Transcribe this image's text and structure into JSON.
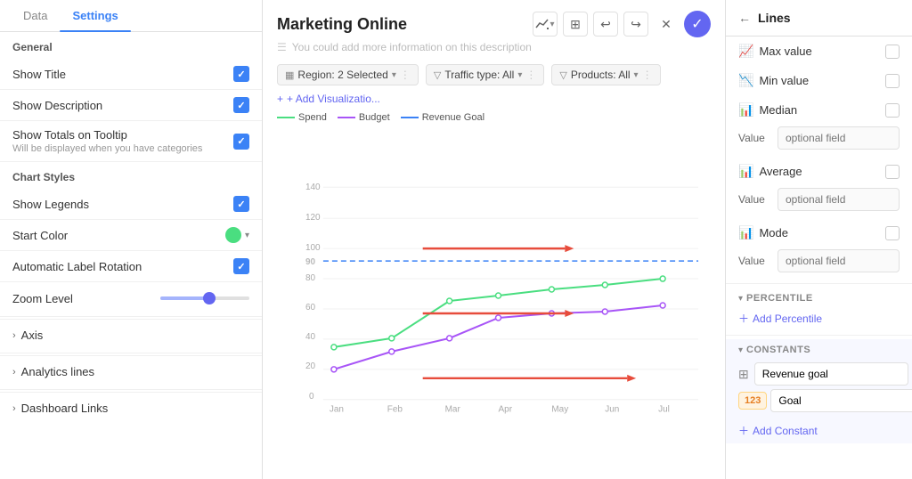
{
  "tabs": [
    {
      "label": "Data",
      "active": false
    },
    {
      "label": "Settings",
      "active": true
    }
  ],
  "left": {
    "general_label": "General",
    "show_title": "Show Title",
    "show_description": "Show Description",
    "show_totals": "Show Totals on Tooltip",
    "show_totals_sub": "Will be displayed when you have categories",
    "chart_styles": "Chart Styles",
    "show_legends": "Show Legends",
    "start_color": "Start Color",
    "auto_label": "Automatic Label Rotation",
    "zoom_level": "Zoom Level",
    "axis": "Axis",
    "analytics_lines": "Analytics lines",
    "dashboard_links": "Dashboard Links"
  },
  "chart": {
    "title": "Marketing Online",
    "description_placeholder": "You could add more information on this description",
    "filters": [
      {
        "label": "Region: 2 Selected",
        "icon": "▦"
      },
      {
        "label": "Traffic type: All",
        "icon": "▽"
      },
      {
        "label": "Products: All",
        "icon": "▽"
      }
    ],
    "add_vis": "+ Add Visualizatio...",
    "legend": [
      {
        "label": "Spend",
        "color": "#4ade80"
      },
      {
        "label": "Budget",
        "color": "#a855f7"
      },
      {
        "label": "Revenue Goal",
        "color": "#3b82f6"
      }
    ]
  },
  "right": {
    "title": "Lines",
    "rows": [
      {
        "label": "Max value",
        "icon": "📈",
        "checked": false
      },
      {
        "label": "Min value",
        "icon": "📉",
        "checked": false
      },
      {
        "label": "Median",
        "icon": "📊",
        "checked": false
      },
      {
        "label": "Average",
        "icon": "📊",
        "checked": false
      },
      {
        "label": "Mode",
        "icon": "📊",
        "checked": false
      }
    ],
    "value_placeholder": "optional field",
    "percentile_label": "PERCENTILE",
    "add_percentile": "Add Percentile",
    "constants_label": "CONSTANTS",
    "add_constant": "Add Constant",
    "revenue_goal_value": "Revenue goal",
    "goal_badge": "123",
    "goal_label": "Goal"
  },
  "header_actions": {
    "chart_icon": "📊",
    "grid_icon": "⊞",
    "undo": "↩",
    "redo": "↪",
    "close": "✕",
    "confirm": "✓"
  }
}
